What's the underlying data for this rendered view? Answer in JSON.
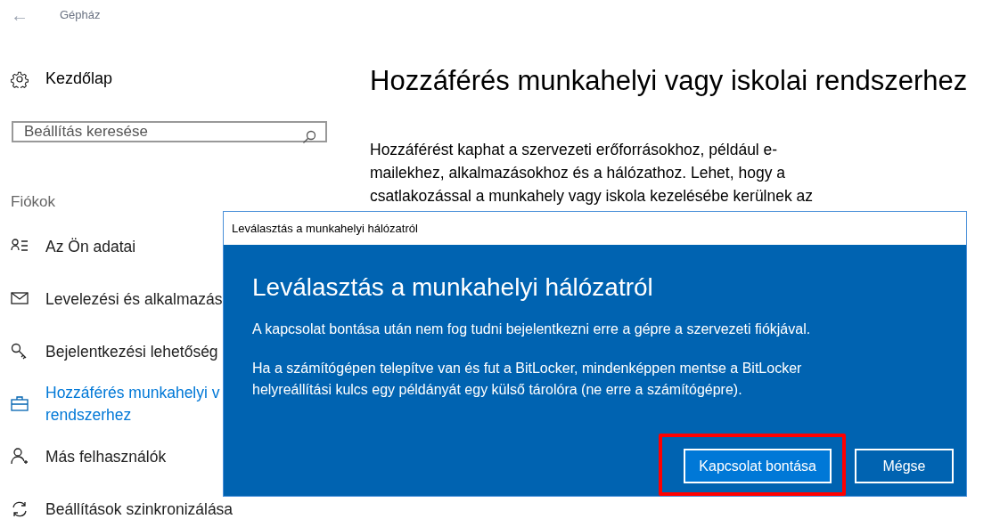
{
  "header": {
    "back": "←",
    "title": "Gépház"
  },
  "home": {
    "label": "Kezdőlap"
  },
  "search": {
    "placeholder": "Beállítás keresése"
  },
  "section": "Fiókok",
  "nav_items": [
    {
      "label": "Az Ön adatai",
      "selected": false
    },
    {
      "label": "Levelezési és alkalmazás",
      "selected": false
    },
    {
      "label": "Bejelentkezési lehetőség",
      "selected": false
    },
    {
      "label": "Hozzáférés munkahelyi v",
      "label_2": "rendszerhez",
      "selected": true
    },
    {
      "label": "Más felhasználók",
      "selected": false
    },
    {
      "label": "Beállítások szinkronizálása",
      "selected": false
    }
  ],
  "page": {
    "title": "Hozzáférés munkahelyi vagy iskolai rendszerhez",
    "paragraph_lines": [
      "Hozzáférést kaphat a szervezeti erőforrásokhoz, például e-",
      "mailekhez, alkalmazásokhoz és a hálózathoz. Lehet, hogy a",
      "csatlakozással a munkahely vagy iskola kezelésébe kerülnek az"
    ]
  },
  "dialog": {
    "window_title": "Leválasztás a munkahelyi hálózatról",
    "heading": "Leválasztás a munkahelyi hálózatról",
    "text_1": "A kapcsolat bontása után nem fog tudni bejelentkezni erre a gépre a szervezeti fiókjával.",
    "text_2": "Ha a számítógépen telepítve van és fut a BitLocker, mindenképpen mentse a BitLocker helyreállítási kulcs egy példányát egy külső tárolóra (ne erre a számítógépre).",
    "buttons": [
      {
        "label": "Kapcsolat bontása",
        "kind": "primary",
        "highlighted": true
      },
      {
        "label": "Mégse",
        "kind": "secondary",
        "highlighted": false
      }
    ]
  }
}
